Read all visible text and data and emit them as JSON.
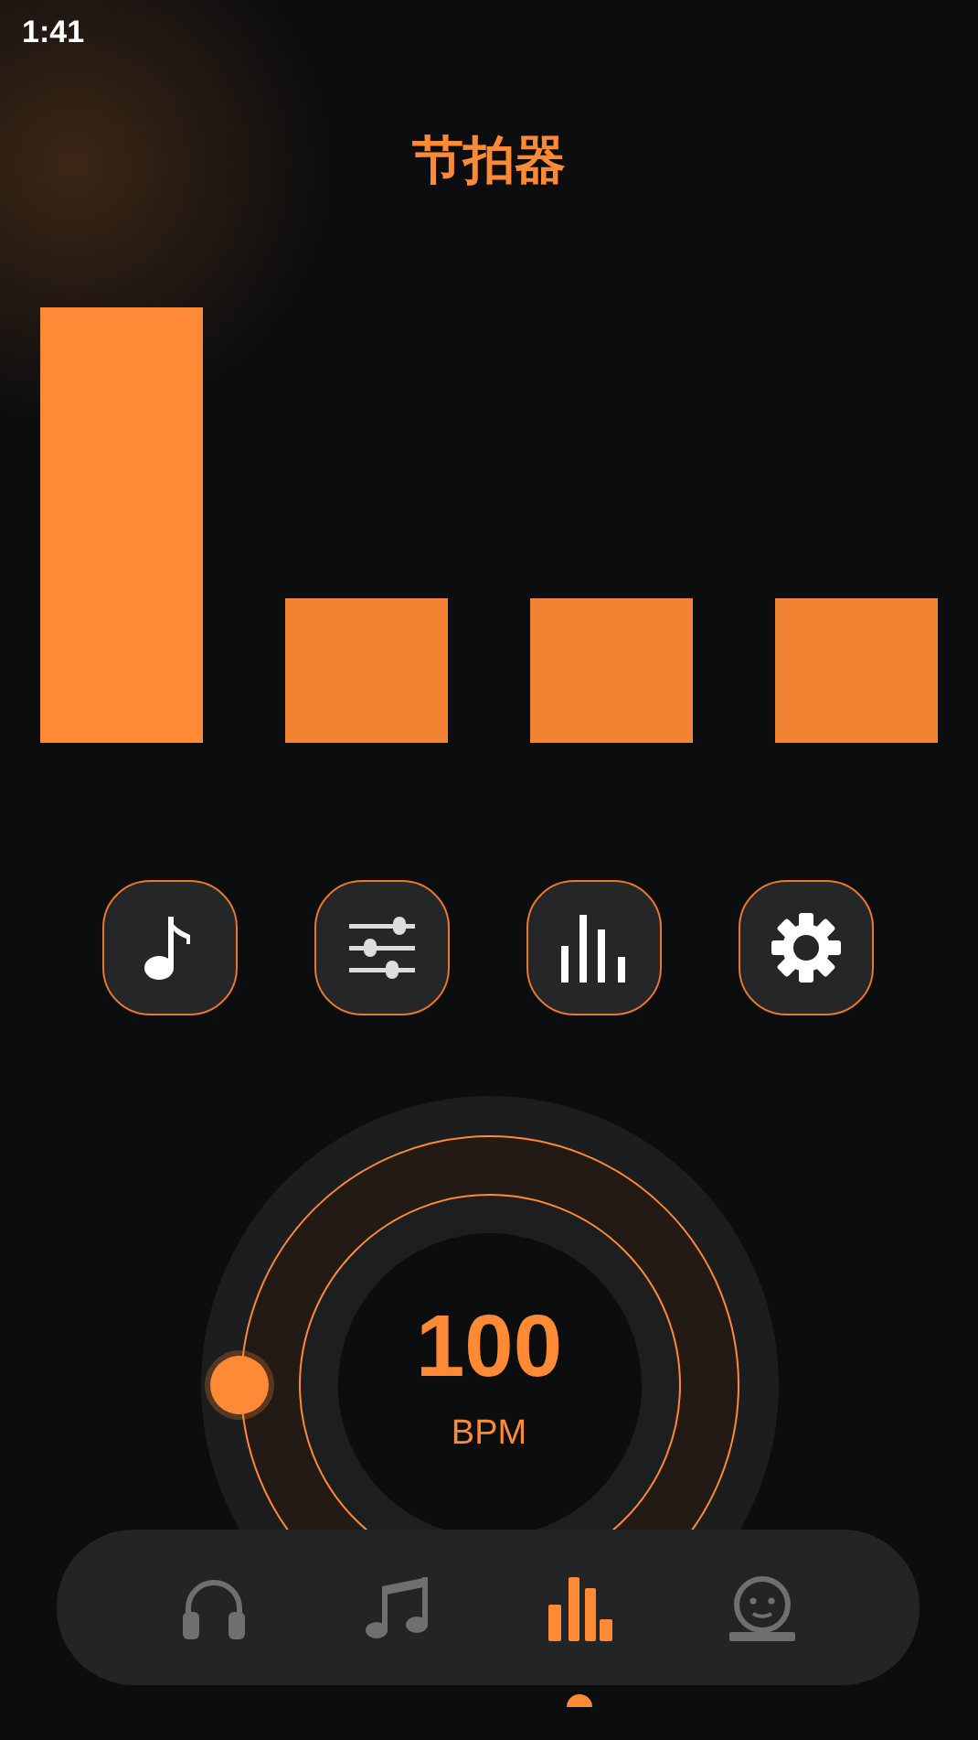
{
  "status_bar": {
    "time": "1:41"
  },
  "title": "节拍器",
  "beats": [
    {
      "accent": true
    },
    {
      "accent": false
    },
    {
      "accent": false
    },
    {
      "accent": false
    }
  ],
  "tools": [
    {
      "kind": "note"
    },
    {
      "kind": "sliders"
    },
    {
      "kind": "bars"
    },
    {
      "kind": "gear"
    }
  ],
  "tempo": {
    "value": "100",
    "unit": "BPM"
  },
  "nav": [
    {
      "kind": "headphones",
      "selected": false
    },
    {
      "kind": "music",
      "selected": false
    },
    {
      "kind": "bars",
      "selected": true
    },
    {
      "kind": "face",
      "selected": false
    }
  ]
}
